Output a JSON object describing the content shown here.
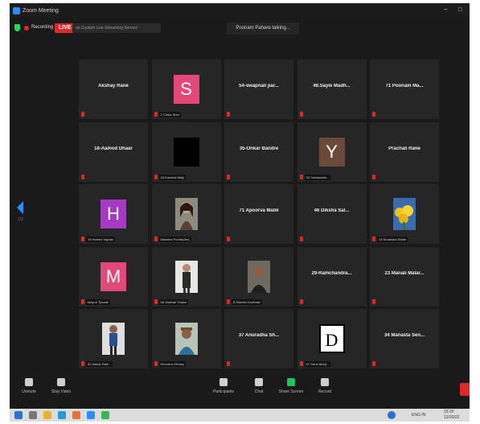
{
  "window": {
    "title": "Zoom Meeting",
    "controls": [
      "–",
      "□"
    ]
  },
  "topbar": {
    "recording_label": "Recording",
    "live_badge": "LIVE",
    "live_url": "on Custom Live Streaming Service",
    "speaking": "Poonam Pahare talking..."
  },
  "grid": {
    "page_indicator": "1/2",
    "tiles": [
      {
        "name": "Akshay Rane",
        "tag": ""
      },
      {
        "initial": "S",
        "avatar_color": "#e2487a",
        "tag": "2 Chitra Shet"
      },
      {
        "name": "54-swapnali par...",
        "tag": ""
      },
      {
        "name": "49.Sayle Madh...",
        "tag": ""
      },
      {
        "name": "71 Poonam Ma...",
        "tag": ""
      },
      {
        "name": "18-Aamod Dhaar",
        "tag": ""
      },
      {
        "avatar_color": "#000000",
        "tag": "28 Kaushal Malji"
      },
      {
        "name": "35-Onkar Bandre",
        "tag": ""
      },
      {
        "initial": "Y",
        "avatar_color": "#6b4a3a",
        "tag": "33 Yashaswini..."
      },
      {
        "name": "Prachali Rane",
        "tag": ""
      },
      {
        "initial": "H",
        "avatar_color": "#a73ac4",
        "tag": "16 Harsha Ingrale"
      },
      {
        "photo": "woman-portrait",
        "tag": "Manisha Ponde(ber)"
      },
      {
        "name": "71 Apoorva Malik",
        "tag": ""
      },
      {
        "name": "46 Diksha Sal...",
        "tag": ""
      },
      {
        "photo": "yellow-flowers",
        "tag": "19 Suraksha Dhale"
      },
      {
        "initial": "M",
        "avatar_color": "#e2487a",
        "tag": "Mayuri Tjavale"
      },
      {
        "photo": "woman-standing",
        "tag": "48 Vaidhali Thakur"
      },
      {
        "photo": "man-portrait",
        "tag": "8 Rakesh Kambale"
      },
      {
        "name": "29-Ramchandra...",
        "tag": ""
      },
      {
        "name": "23 Manali Malar...",
        "tag": ""
      },
      {
        "photo": "man-standing",
        "tag": "52 Aditya Patil..."
      },
      {
        "photo": "man-hat",
        "tag": "Hirendra Gholap"
      },
      {
        "name": "37 Anuradha Sh...",
        "tag": ""
      },
      {
        "initial": "D",
        "avatar_color": "#ffffff",
        "tag": "67 Gauri Abhij..."
      },
      {
        "name": "34 Manasta Sen...",
        "tag": ""
      }
    ]
  },
  "toolbar": {
    "unmute": "Unmute",
    "start_video": "Stop Video",
    "participants": "Participants",
    "participants_count": "114",
    "chat": "Chat",
    "share": "Share Screen",
    "record": "Record"
  },
  "taskbar": {
    "time": "15:20",
    "date": "12/20/22",
    "lang": "ENG IN"
  },
  "colors": {
    "accent": "#2d8cff",
    "live": "#e02828",
    "share": "#1bc35b"
  }
}
